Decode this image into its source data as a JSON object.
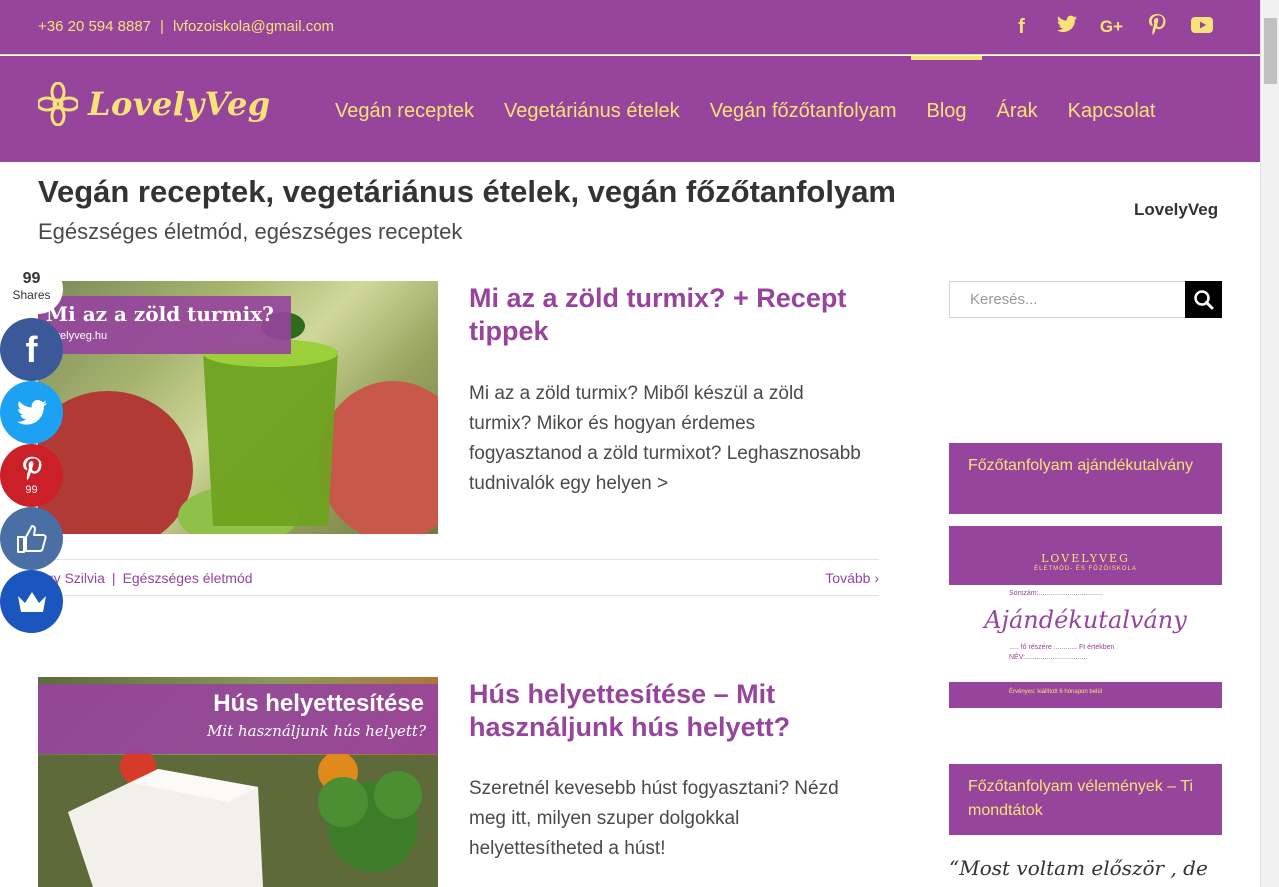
{
  "topbar": {
    "phone": "+36 20 594 8887",
    "separator": "|",
    "email": "lvfozoiskola@gmail.com",
    "social": [
      {
        "icon": "facebook-icon",
        "glyph": "f"
      },
      {
        "icon": "twitter-icon",
        "glyph": "🐦"
      },
      {
        "icon": "google-plus-icon",
        "glyph": "G+"
      },
      {
        "icon": "pinterest-icon",
        "glyph": "P"
      },
      {
        "icon": "youtube-icon",
        "glyph": "▶"
      }
    ]
  },
  "header": {
    "brand": "LovelyVeg",
    "nav": [
      {
        "label": "Vegán receptek",
        "active": false
      },
      {
        "label": "Vegetáriánus ételek",
        "active": false
      },
      {
        "label": "Vegán főzőtanfolyam",
        "active": false
      },
      {
        "label": "Blog",
        "active": true
      },
      {
        "label": "Árak",
        "active": false
      },
      {
        "label": "Kapcsolat",
        "active": false
      }
    ]
  },
  "page": {
    "title": "Vegán receptek, vegetáriánus ételek, vegán főzőtanfolyam",
    "subtitle": "Egészséges életmód, egészséges receptek",
    "site_name": "LovelyVeg"
  },
  "share": {
    "count": "99",
    "label": "Shares",
    "buttons": [
      {
        "name": "facebook-share-button",
        "icon": "facebook-icon",
        "glyph": "f",
        "color": "#3b5998",
        "count": ""
      },
      {
        "name": "twitter-share-button",
        "icon": "twitter-icon",
        "glyph": "🐦",
        "color": "#1da1f2",
        "count": ""
      },
      {
        "name": "pinterest-share-button",
        "icon": "pinterest-icon",
        "glyph": "P",
        "color": "#cb2027",
        "count": "99"
      },
      {
        "name": "like-share-button",
        "icon": "thumbs-up-icon",
        "glyph": "👍",
        "color": "#4a6fa5",
        "count": ""
      },
      {
        "name": "sumo-share-button",
        "icon": "crown-icon",
        "glyph": "♛",
        "color": "#1a56be",
        "count": ""
      }
    ]
  },
  "posts": [
    {
      "image_banner": "Mi az a zöld turmix?",
      "image_sub": "lovelyveg.hu",
      "title": "Mi az a zöld turmix? + Recept tippek",
      "excerpt": "Mi az a zöld turmix? Miből készül a zöld turmix? Mikor és hogyan érdemes fogyasztanod a zöld turmixot? Leghasznosabb tudnivalók egy helyen >",
      "author": "Nagy Szilvia",
      "author_visible": "agy Szilvia",
      "meta_sep": "|",
      "category": "Egészséges életmód",
      "more": "Tovább"
    },
    {
      "image_banner": "Hús helyettesítése",
      "image_sub": "Mit használjunk hús helyett?",
      "title": "Hús helyettesítése – Mit használjunk hús helyett?",
      "excerpt": "Szeretnél kevesebb húst fogyasztani? Nézd meg itt, milyen szuper dolgokkal helyettesítheted a húst!"
    }
  ],
  "sidebar": {
    "search_placeholder": "Keresés...",
    "widget1_title": "Főzőtanfolyam ajándékutalvány",
    "voucher": {
      "brand": "LOVELYVEG",
      "tagline": "ÉLETMÓD- ÉS FŐZŐISKOLA",
      "heading": "Ajándékutalvány",
      "serial": "Sorszám:.................................",
      "people": "..... fő részére ............ Ft értékben",
      "name": "NÉV:................................",
      "validity": "Érvényes:          kiállított 6 hónapon belül"
    },
    "widget2_title": "Főzőtanfolyam vélemények – Ti mondtátok",
    "quote": "“Most voltam először , de"
  },
  "colors": {
    "brand_purple": "#96449c",
    "accent_yellow": "#f7e27a",
    "text_dark": "#333333"
  }
}
